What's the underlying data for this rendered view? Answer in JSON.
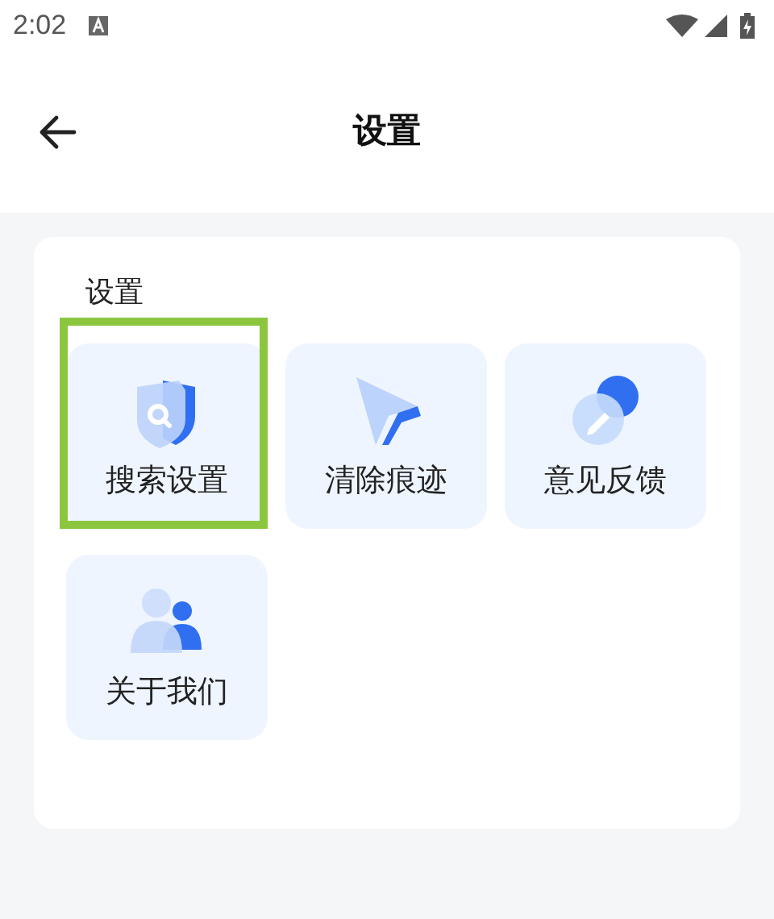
{
  "status_bar": {
    "time": "2:02"
  },
  "header": {
    "title": "设置"
  },
  "section": {
    "title": "设置",
    "items": [
      {
        "label": "搜索设置",
        "kind": "shield",
        "highlighted": true
      },
      {
        "label": "清除痕迹",
        "kind": "pointer",
        "highlighted": false
      },
      {
        "label": "意见反馈",
        "kind": "pen",
        "highlighted": false
      },
      {
        "label": "关于我们",
        "kind": "people",
        "highlighted": false
      }
    ]
  }
}
